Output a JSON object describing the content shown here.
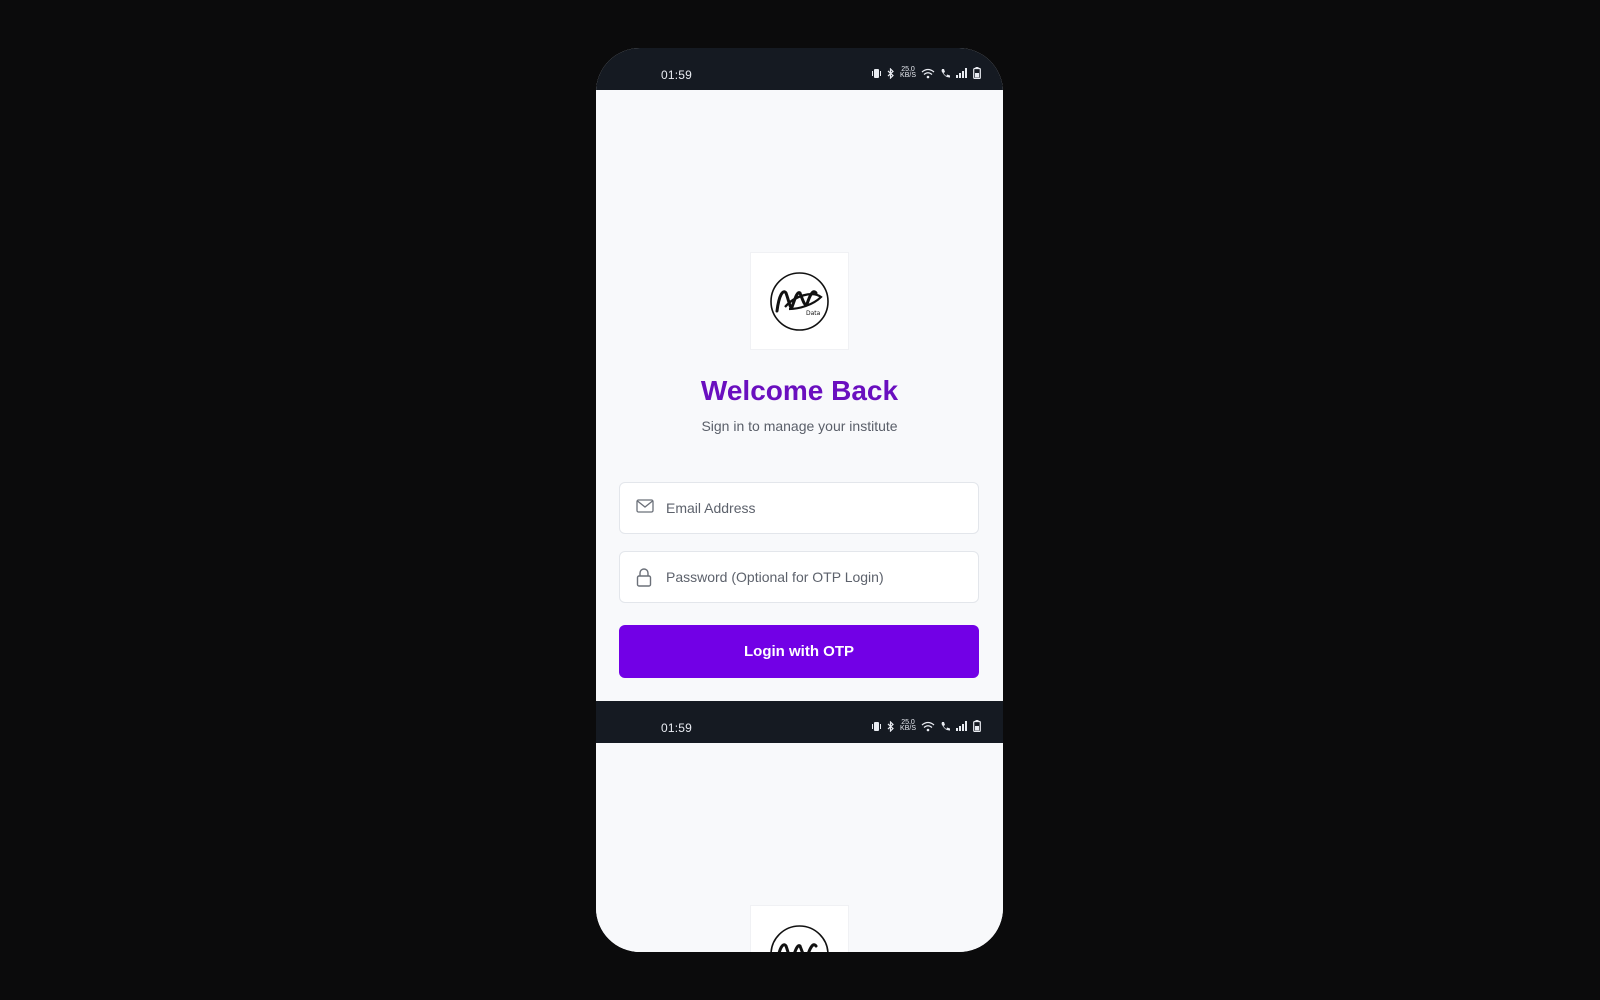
{
  "status_bar": {
    "time": "01:59",
    "speed_top": "25.0",
    "speed_bottom": "KB/S"
  },
  "login": {
    "logo_text": "Data",
    "title": "Welcome Back",
    "subtitle": "Sign in to manage your institute",
    "email": {
      "placeholder": "Email Address",
      "value": ""
    },
    "password": {
      "placeholder": "Password (Optional for OTP Login)",
      "value": ""
    },
    "submit_label": "Login with OTP"
  },
  "colors": {
    "accent": "#7200e6",
    "title": "#6a0fbf",
    "statusbar": "#151a22",
    "backdrop": "#0b0b0c"
  },
  "icons": [
    "vibrate-icon",
    "bluetooth-icon",
    "wifi-icon",
    "call-icon",
    "signal-icon",
    "battery-icon",
    "mail-icon",
    "lock-icon"
  ]
}
